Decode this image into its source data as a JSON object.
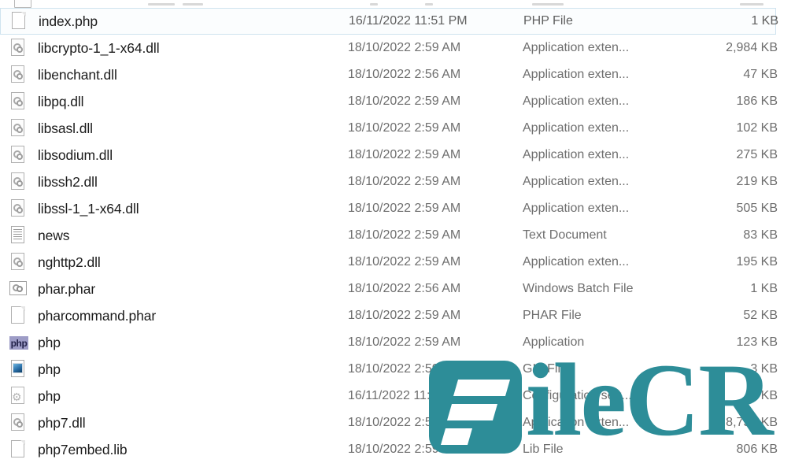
{
  "window": {
    "view": "details-list",
    "accent_selection_border": "#cfe3ef",
    "text_primary": "#1b1b1b",
    "text_secondary": "#6e6e6e"
  },
  "columns": [
    "Name",
    "Date modified",
    "Type",
    "Size"
  ],
  "rows": [
    {
      "name": "index.php",
      "date": "16/11/2022 11:51 PM",
      "type": "PHP File",
      "size": "1 KB",
      "icon": "page-icon",
      "selected": true
    },
    {
      "name": "libcrypto-1_1-x64.dll",
      "date": "18/10/2022 2:59 AM",
      "type": "Application exten...",
      "size": "2,984 KB",
      "icon": "dll-icon",
      "selected": false
    },
    {
      "name": "libenchant.dll",
      "date": "18/10/2022 2:56 AM",
      "type": "Application exten...",
      "size": "47 KB",
      "icon": "dll-icon",
      "selected": false
    },
    {
      "name": "libpq.dll",
      "date": "18/10/2022 2:59 AM",
      "type": "Application exten...",
      "size": "186 KB",
      "icon": "dll-icon",
      "selected": false
    },
    {
      "name": "libsasl.dll",
      "date": "18/10/2022 2:59 AM",
      "type": "Application exten...",
      "size": "102 KB",
      "icon": "dll-icon",
      "selected": false
    },
    {
      "name": "libsodium.dll",
      "date": "18/10/2022 2:59 AM",
      "type": "Application exten...",
      "size": "275 KB",
      "icon": "dll-icon",
      "selected": false
    },
    {
      "name": "libssh2.dll",
      "date": "18/10/2022 2:59 AM",
      "type": "Application exten...",
      "size": "219 KB",
      "icon": "dll-icon",
      "selected": false
    },
    {
      "name": "libssl-1_1-x64.dll",
      "date": "18/10/2022 2:59 AM",
      "type": "Application exten...",
      "size": "505 KB",
      "icon": "dll-icon",
      "selected": false
    },
    {
      "name": "news",
      "date": "18/10/2022 2:59 AM",
      "type": "Text Document",
      "size": "83 KB",
      "icon": "text-document-icon",
      "selected": false
    },
    {
      "name": "nghttp2.dll",
      "date": "18/10/2022 2:59 AM",
      "type": "Application exten...",
      "size": "195 KB",
      "icon": "dll-icon",
      "selected": false
    },
    {
      "name": "phar.phar",
      "date": "18/10/2022 2:56 AM",
      "type": "Windows Batch File",
      "size": "1 KB",
      "icon": "batch-file-icon",
      "selected": false
    },
    {
      "name": "pharcommand.phar",
      "date": "18/10/2022 2:59 AM",
      "type": "PHAR File",
      "size": "52 KB",
      "icon": "page-icon",
      "selected": false
    },
    {
      "name": "php",
      "date": "18/10/2022 2:59 AM",
      "type": "Application",
      "size": "123 KB",
      "icon": "php-application-icon",
      "selected": false
    },
    {
      "name": "php",
      "date": "18/10/2022 2:59 AM",
      "type": "GIF File",
      "size": "3 KB",
      "icon": "gif-image-icon",
      "selected": false
    },
    {
      "name": "php",
      "date": "16/11/2022 11:51 PM",
      "type": "Configuration sett...",
      "size": "7 KB",
      "icon": "configuration-settings-icon",
      "selected": false
    },
    {
      "name": "php7.dll",
      "date": "18/10/2022 2:59 AM",
      "type": "Application exten...",
      "size": "8,755 KB",
      "icon": "dll-icon",
      "selected": false
    },
    {
      "name": "php7embed.lib",
      "date": "18/10/2022 2:59 AM",
      "type": "Lib File",
      "size": "806 KB",
      "icon": "page-icon",
      "selected": false
    }
  ],
  "watermark": {
    "text": "ileCR",
    "logo_letter": "F",
    "color": "#2d8d98"
  }
}
